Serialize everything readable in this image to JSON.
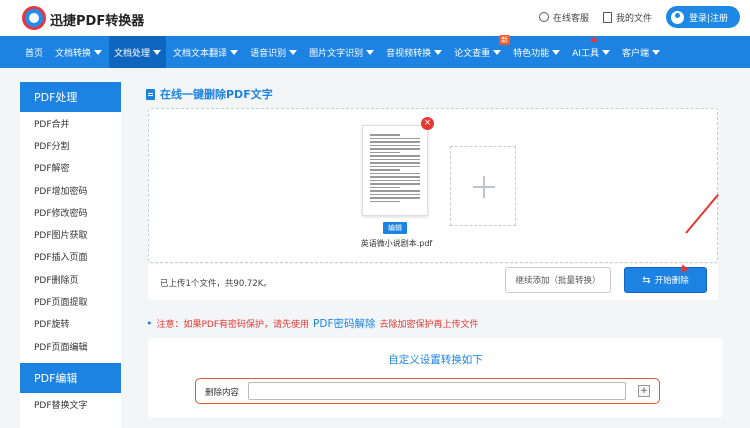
{
  "header": {
    "brand": "迅捷PDF转换器",
    "help_label": "在线客服",
    "my_files_label": "我的文件",
    "login_label": "登录|注册"
  },
  "nav": {
    "items": [
      {
        "label": "首页",
        "caret": false
      },
      {
        "label": "文档转换",
        "caret": true
      },
      {
        "label": "文档处理",
        "caret": true,
        "active": true
      },
      {
        "label": "文档文本翻译",
        "caret": true
      },
      {
        "label": "语音识别",
        "caret": true
      },
      {
        "label": "图片文字识别",
        "caret": true
      },
      {
        "label": "音视频转换",
        "caret": true
      },
      {
        "label": "论文查重",
        "caret": true,
        "badge": "新"
      },
      {
        "label": "特色功能",
        "caret": true
      },
      {
        "label": "AI工具",
        "caret": true
      },
      {
        "label": "客户端",
        "caret": true
      }
    ]
  },
  "sidebar": {
    "section1": "PDF处理",
    "items": [
      "PDF合并",
      "PDF分割",
      "PDF解密",
      "PDF增加密码",
      "PDF修改密码",
      "PDF图片获取",
      "PDF插入页面",
      "PDF删除页",
      "PDF页面提取",
      "PDF旋转",
      "PDF页面编辑"
    ],
    "section2": "PDF编辑",
    "items2": [
      "PDF替换文字"
    ]
  },
  "main": {
    "title": "在线一键删除PDF文字",
    "file": {
      "name": "英语微小说剧本.pdf",
      "edit_label": "编辑",
      "delete_symbol": "×"
    },
    "info_text": "已上传1个文件，共90.72K。",
    "continue_label": "继续添加（批量转换）",
    "start_label": "开始删除",
    "note_prefix": "注意：如果PDF有密码保护，请先使用",
    "note_link": "PDF密码解除",
    "note_suffix": "去除加密保护再上传文件",
    "settings_title": "自定义设置转换如下",
    "delete_content_label": "删除内容",
    "delete_content_value": "",
    "plus_symbol": "+"
  }
}
